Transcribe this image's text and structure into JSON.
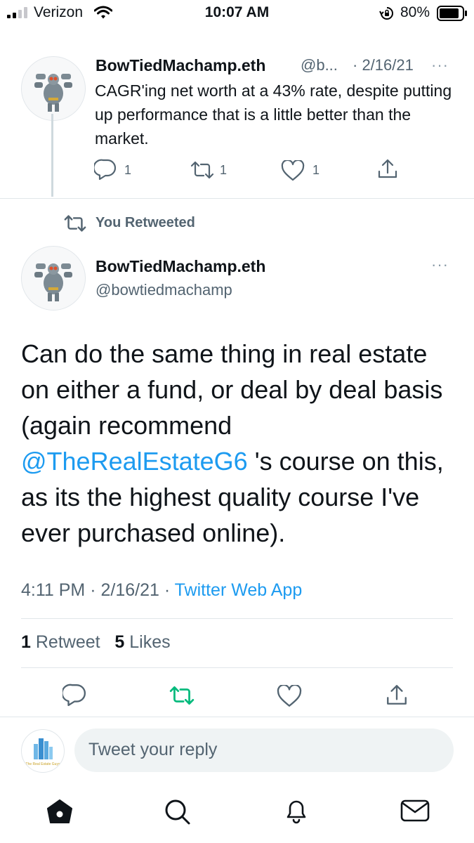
{
  "status_bar": {
    "carrier": "Verizon",
    "time": "10:07 AM",
    "battery": "80%"
  },
  "parent_tweet": {
    "name": "BowTiedMachamp.eth",
    "handle": "@b...",
    "date": "· 2/16/21",
    "more": "···",
    "text": "CAGR'ing net worth at a 43% rate, despite putting up performance that is a little better than the market.",
    "replies": "1",
    "retweets": "1",
    "likes": "1"
  },
  "social_context": "You Retweeted",
  "main_tweet": {
    "name": "BowTiedMachamp.eth",
    "handle": "@bowtiedmachamp",
    "more": "···",
    "text_before": "Can do the same thing in real estate on either a fund, or deal by deal basis (again recommend ",
    "mention": "@TheRealEstateG6",
    "text_after": " 's course on this, as its the highest quality course I've ever purchased online).",
    "time": "4:11 PM",
    "date": "2/16/21",
    "separator": " · ",
    "source": "Twitter Web App",
    "retweet_count": "1",
    "retweet_label": "Retweet",
    "like_count": "5",
    "like_label": "Likes"
  },
  "reply": {
    "placeholder": "Tweet your reply",
    "user_avatar_text": "The Real Estate Guys"
  },
  "colors": {
    "accent": "#1d9bf0",
    "retweet_green": "#00ba7c",
    "muted": "#536471"
  },
  "icons": {
    "status": [
      "signal-icon",
      "wifi-icon",
      "rotation-lock-icon",
      "battery-icon"
    ],
    "actions": [
      "reply-icon",
      "retweet-icon",
      "like-icon",
      "share-icon"
    ],
    "tabs": [
      "home-icon",
      "search-icon",
      "notifications-icon",
      "messages-icon"
    ]
  }
}
